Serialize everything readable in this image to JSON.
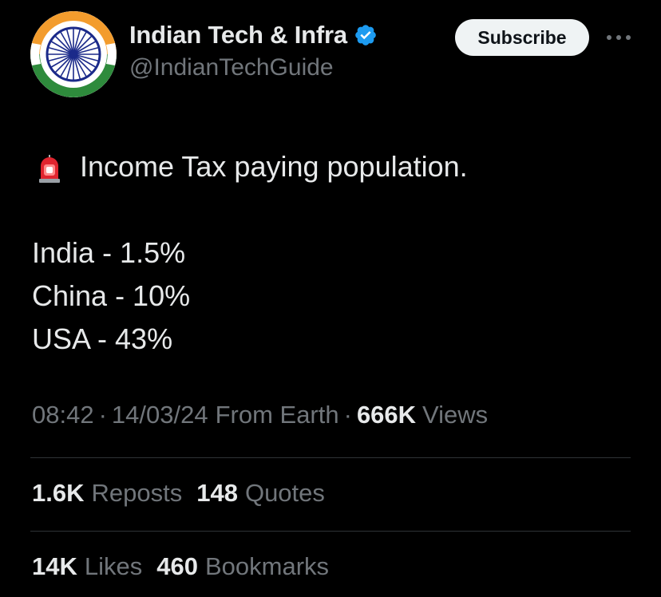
{
  "tweet": {
    "author": {
      "display_name": "Indian Tech & Infra",
      "handle": "@IndianTechGuide",
      "verified_icon": "verified-badge-icon",
      "avatar_icon": "indian-flag-chakra-avatar"
    },
    "subscribe_label": "Subscribe",
    "more_icon": "more-dots-icon",
    "body": {
      "emoji_icon": "police-siren-icon",
      "headline": "Income Tax paying population.",
      "lines": [
        "India - 1.5%",
        "China - 10%",
        "USA - 43%"
      ]
    },
    "meta": {
      "time": "08:42",
      "date": "14/03/24",
      "source": "From Earth",
      "separator": "·",
      "views_count": "666K",
      "views_label": "Views"
    },
    "stats_row1": {
      "reposts_count": "1.6K",
      "reposts_label": "Reposts",
      "quotes_count": "148",
      "quotes_label": "Quotes"
    },
    "stats_row2": {
      "likes_count": "14K",
      "likes_label": "Likes",
      "bookmarks_count": "460",
      "bookmarks_label": "Bookmarks"
    }
  },
  "colors": {
    "background": "#000000",
    "primary_text": "#e7e9ea",
    "secondary_text": "#71767b",
    "divider": "#2f3336",
    "verified_blue": "#1d9bf0",
    "subscribe_bg": "#eff3f4",
    "saffron": "#f39c2d",
    "green": "#2e8b3c",
    "chakra_navy": "#1b2a8a",
    "siren_red": "#e0252f"
  }
}
